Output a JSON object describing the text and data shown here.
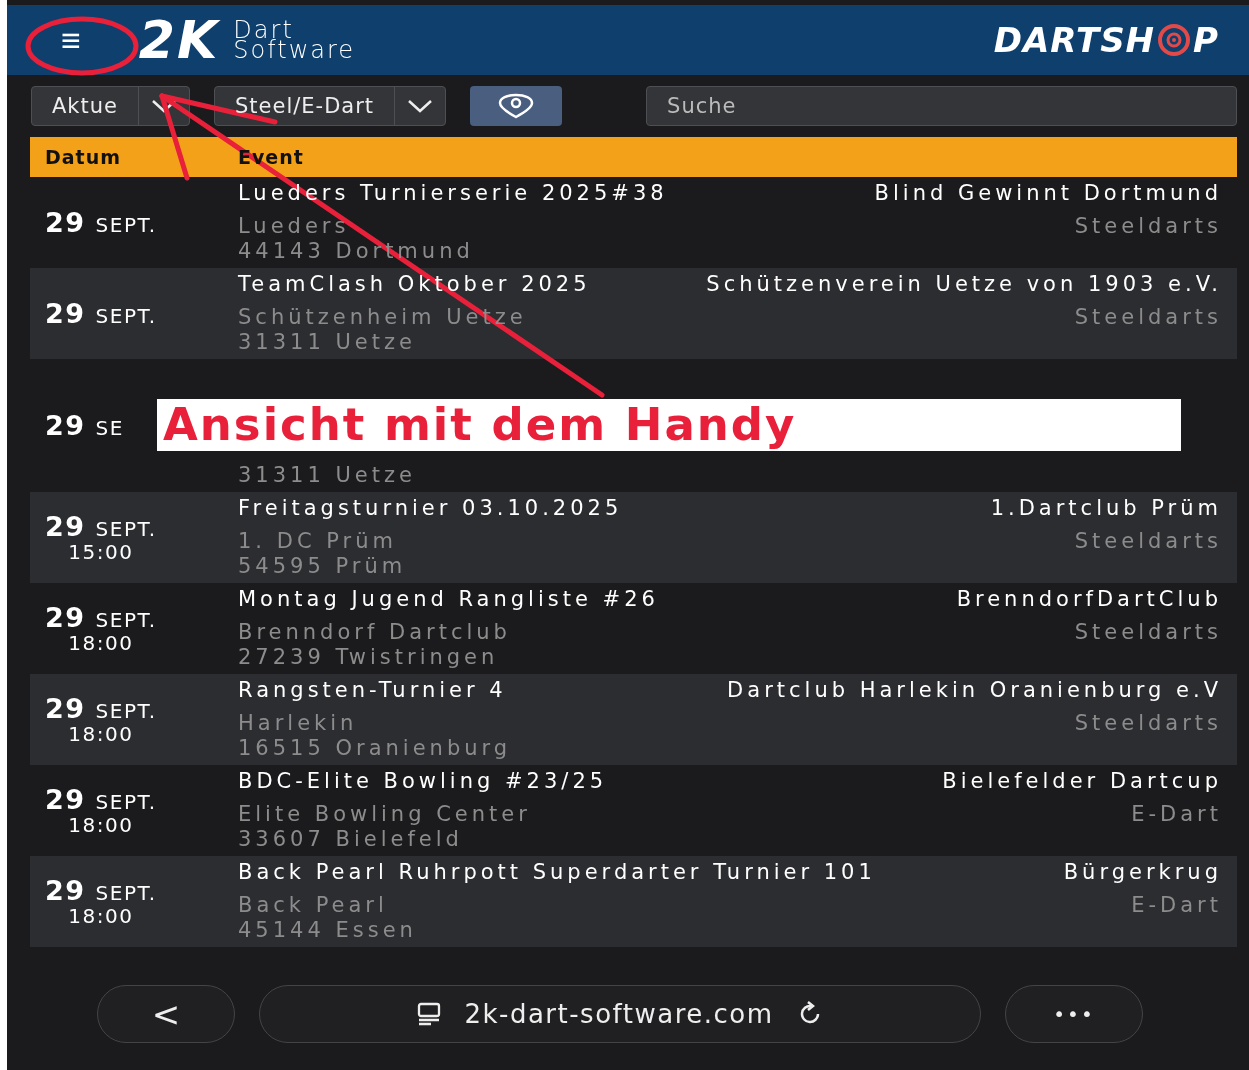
{
  "header": {
    "menu": "≡",
    "logo_mark": "2K",
    "logo_line1": "Dart",
    "logo_line2": "Software",
    "shop_logo_start": "DARTSH",
    "shop_logo_end": "P"
  },
  "filters": [
    {
      "kind": "dropdown",
      "value": "Aktue"
    },
    {
      "kind": "dropdown",
      "value": "Steel/E-Dart"
    },
    {
      "kind": "location"
    },
    {
      "kind": "search",
      "placeholder": "Suche"
    }
  ],
  "table": {
    "columns": [
      "Datum",
      "Event"
    ],
    "rows": [
      {
        "day": "29",
        "month": "SEPT.",
        "title": "Lueders Turnierserie 2025#38",
        "organizer": "Blind Gewinnt Dortmund",
        "venue": "Lueders",
        "category": "Steeldarts",
        "city": "44143 Dortmund"
      },
      {
        "day": "29",
        "month": "SEPT.",
        "title": "TeamClash Oktober 2025",
        "organizer": "Schützenverein Uetze von 1903 e.V.",
        "venue": "Schützenheim Uetze",
        "category": "Steeldarts",
        "city": "31311 Uetze"
      },
      {
        "day": "29",
        "month": "SE",
        "city": "31311 Uetze"
      },
      {
        "day": "29",
        "month": "SEPT.",
        "time": "15:00",
        "title": "Freitagsturnier 03.10.2025",
        "organizer": "1.Dartclub Prüm",
        "venue": "1. DC Prüm",
        "category": "Steeldarts",
        "city": "54595 Prüm"
      },
      {
        "day": "29",
        "month": "SEPT.",
        "time": "18:00",
        "title": "Montag Jugend Rangliste #26",
        "organizer": "BrenndorfDartClub",
        "venue": "Brenndorf Dartclub",
        "category": "Steeldarts",
        "city": "27239 Twistringen"
      },
      {
        "day": "29",
        "month": "SEPT.",
        "time": "18:00",
        "title": "Rangsten-Turnier 4",
        "organizer": "Dartclub Harlekin Oranienburg e.V",
        "venue": "Harlekin",
        "category": "Steeldarts",
        "city": "16515 Oranienburg"
      },
      {
        "day": "29",
        "month": "SEPT.",
        "time": "18:00",
        "title": "BDC-Elite Bowling #23/25",
        "organizer": "Bielefelder Dartcup",
        "venue": "Elite Bowling Center",
        "category": "E-Dart",
        "city": "33607 Bielefeld"
      },
      {
        "day": "29",
        "month": "SEPT.",
        "time": "18:00",
        "title": "Back Pearl Ruhrpott Superdarter Turnier 101",
        "organizer": "Bürgerkrug",
        "venue": "Back Pearl",
        "category": "E-Dart",
        "city": "45144 Essen"
      }
    ]
  },
  "browser_bar": {
    "back": "<",
    "url": "2k-dart-software.com",
    "more": "•••"
  },
  "annotation": {
    "label": "Ansicht mit dem Handy"
  }
}
